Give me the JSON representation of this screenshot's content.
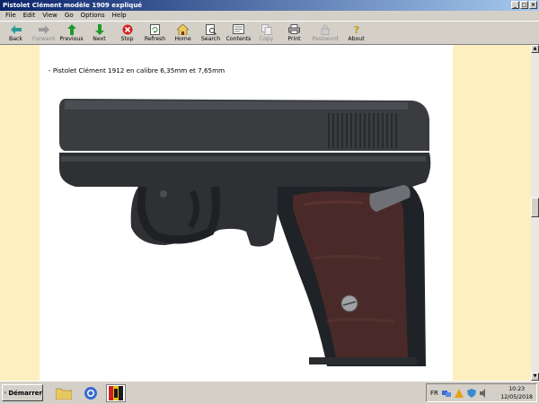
{
  "window": {
    "title": "Pistolet Clément modèle 1909 expliqué",
    "controls": [
      "_",
      "□",
      "×"
    ]
  },
  "menu": [
    "File",
    "Edit",
    "View",
    "Go",
    "Options",
    "Help"
  ],
  "toolbar": [
    {
      "label": "Back",
      "icon": "back-arrow-icon",
      "disabled": false
    },
    {
      "label": "Forward",
      "icon": "forward-arrow-icon",
      "disabled": true
    },
    {
      "label": "Previous",
      "icon": "up-arrow-icon",
      "disabled": false
    },
    {
      "label": "Next",
      "icon": "down-arrow-icon",
      "disabled": false
    },
    {
      "label": "Stop",
      "icon": "stop-icon",
      "disabled": false
    },
    {
      "label": "Refresh",
      "icon": "refresh-icon",
      "disabled": false
    },
    {
      "label": "Home",
      "icon": "home-icon",
      "disabled": false
    },
    {
      "label": "Search",
      "icon": "search-icon",
      "disabled": false
    },
    {
      "label": "Contents",
      "icon": "contents-icon",
      "disabled": false
    },
    {
      "label": "Copy",
      "icon": "copy-icon",
      "disabled": true
    },
    {
      "label": "Print",
      "icon": "print-icon",
      "disabled": false
    },
    {
      "label": "Password",
      "icon": "password-icon",
      "disabled": true
    },
    {
      "label": "About",
      "icon": "about-icon",
      "disabled": false
    }
  ],
  "content": {
    "caption": "- Pistolet Clément 1912 en calibre 6,35mm et 7,65mm"
  },
  "taskbar": {
    "start_label": "Démarrer",
    "language": "FR",
    "time": "10:23",
    "date": "12/05/2018"
  },
  "colors": {
    "content_background": "#fdefbf",
    "titlebar": "#0a246a"
  }
}
